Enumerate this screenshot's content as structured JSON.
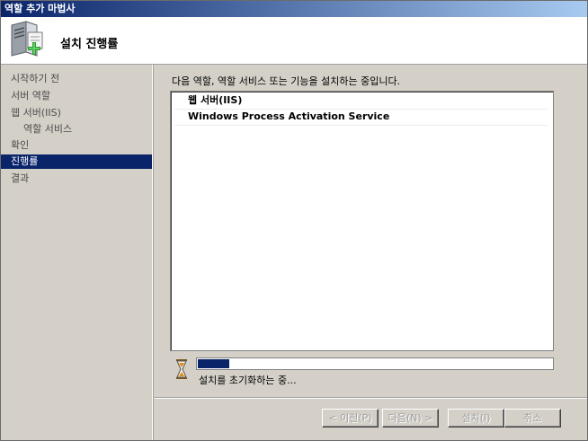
{
  "window": {
    "title": "역할 추가 마법사"
  },
  "header": {
    "title": "설치 진행률",
    "icon": "server-add-icon"
  },
  "sidebar": {
    "items": [
      {
        "label": "시작하기 전",
        "active": false,
        "sub": false
      },
      {
        "label": "서버 역할",
        "active": false,
        "sub": false
      },
      {
        "label": "웹 서버(IIS)",
        "active": false,
        "sub": false
      },
      {
        "label": "역할 서비스",
        "active": false,
        "sub": true
      },
      {
        "label": "확인",
        "active": false,
        "sub": false
      },
      {
        "label": "진행률",
        "active": true,
        "sub": false
      },
      {
        "label": "결과",
        "active": false,
        "sub": false
      }
    ]
  },
  "main": {
    "intro": "다음 역할, 역할 서비스 또는 기능을 설치하는 중입니다.",
    "items": [
      {
        "label": "웹 서버(IIS)"
      },
      {
        "label": "Windows Process Activation Service"
      }
    ],
    "progress": {
      "fraction": 0.09
    },
    "status": "설치를 초기화하는 중..."
  },
  "buttons": {
    "prev": "< 이전(P)",
    "next": "다음(N) >",
    "install": "설치(I)",
    "cancel": "취소"
  },
  "colors": {
    "accent": "#0a246a",
    "titlebar_end": "#a6caf0",
    "dialog_bg": "#d4d0c8"
  }
}
